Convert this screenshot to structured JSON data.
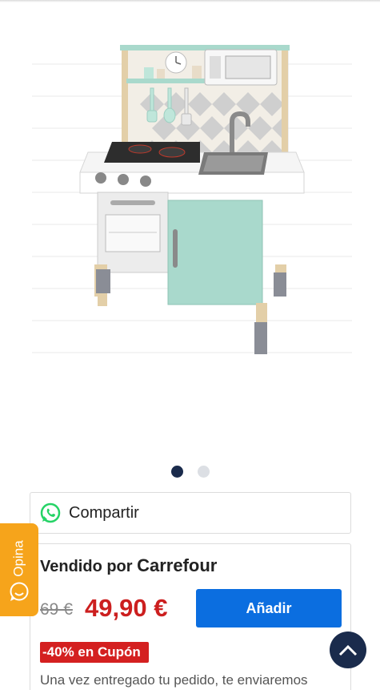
{
  "share": {
    "label": "Compartir",
    "icon": "whatsapp-icon"
  },
  "seller": {
    "prefix": "Vendido por",
    "brand": "Carrefour"
  },
  "price": {
    "old": "69 €",
    "current": "49,90 €"
  },
  "cart": {
    "add_label": "Añadir"
  },
  "coupon": {
    "label": "-40% en Cupón"
  },
  "description": "Una vez entregado tu pedido, te enviaremos",
  "feedback": {
    "label": "Opina",
    "icon": "smile-chat-icon"
  },
  "carousel": {
    "total": 2,
    "active": 1
  },
  "colors": {
    "accent_blue": "#0b6ee0",
    "price_red": "#cc1f1f",
    "coupon_red": "#d42020",
    "feedback_orange": "#f6a41b",
    "navy": "#1a2b4c",
    "whatsapp_green": "#25d366"
  }
}
